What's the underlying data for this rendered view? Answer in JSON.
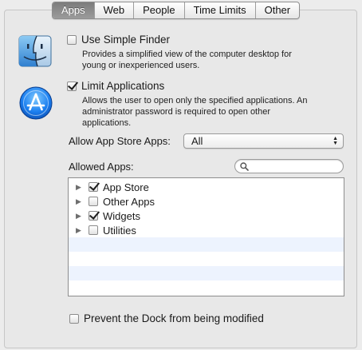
{
  "tabs": [
    {
      "label": "Apps",
      "selected": true
    },
    {
      "label": "Web",
      "selected": false
    },
    {
      "label": "People",
      "selected": false
    },
    {
      "label": "Time Limits",
      "selected": false
    },
    {
      "label": "Other",
      "selected": false
    }
  ],
  "simple_finder": {
    "label": "Use Simple Finder",
    "checked": false,
    "description_lines": [
      "Provides a simplified view of the computer desktop for",
      "young or inexperienced users."
    ],
    "icon": "finder-icon"
  },
  "limit_apps": {
    "label": "Limit Applications",
    "checked": true,
    "description_lines": [
      "Allows the user to open only the specified applications. An",
      "administrator password is required to open other",
      "applications."
    ],
    "icon": "app-store-icon"
  },
  "app_store_apps": {
    "label": "Allow App Store Apps:",
    "selected": "All"
  },
  "allowed_apps": {
    "label": "Allowed Apps:",
    "search_placeholder": "",
    "items": [
      {
        "name": "App Store",
        "checked": true
      },
      {
        "name": "Other Apps",
        "checked": false
      },
      {
        "name": "Widgets",
        "checked": true
      },
      {
        "name": "Utilities",
        "checked": false
      }
    ]
  },
  "prevent_dock": {
    "label": "Prevent the Dock from being modified",
    "checked": false
  },
  "colors": {
    "selected_tab": "#8a8a8a",
    "list_alt_row": "#edf3fe",
    "panel_bg": "#e8e8e8"
  }
}
